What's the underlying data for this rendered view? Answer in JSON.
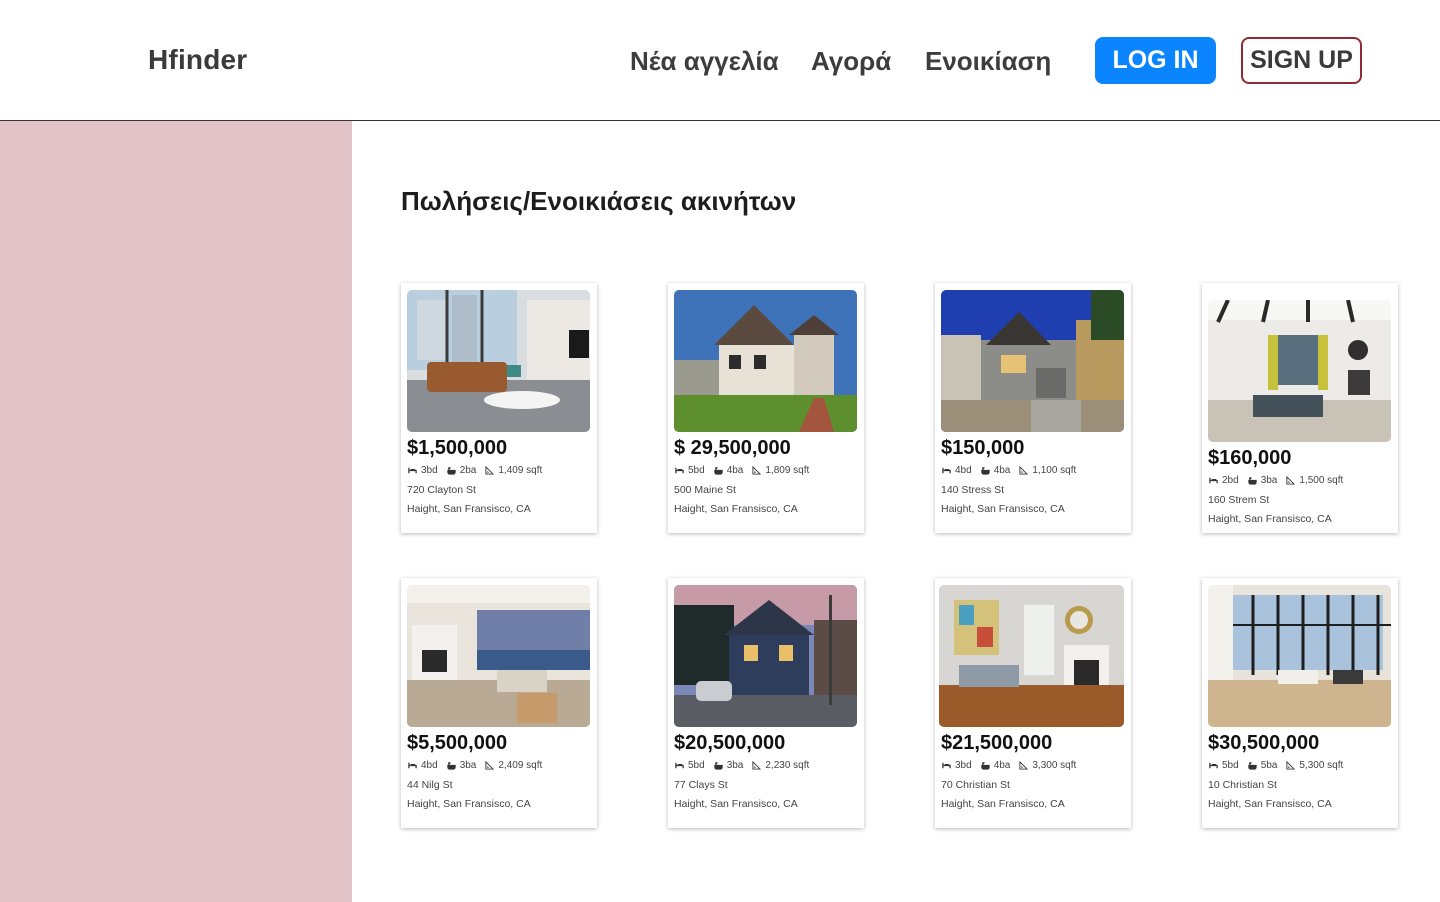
{
  "header": {
    "brand": "Hfinder",
    "nav": {
      "new_listing": "Νέα αγγελία",
      "buy": "Αγορά",
      "rent": "Ενοικίαση"
    },
    "login_label": "LOG IN",
    "signup_label": "SIGN UP"
  },
  "colors": {
    "login_bg": "#0a84ff",
    "signup_border": "#8f2a36",
    "sidebar_bg": "#e2c3c8"
  },
  "main": {
    "title": "Πωλήσεις/Ενοικιάσεις ακινήτων",
    "listings": [
      {
        "price": "$1,500,000",
        "beds": "3bd",
        "baths": "2ba",
        "area": "1,409 sqft",
        "street": "720 Clayton St",
        "city": "Haight, San Fransisco, CA",
        "photo": "living-room-photo"
      },
      {
        "price": "$ 29,500,000",
        "beds": "5bd",
        "baths": "4ba",
        "area": "1,809 sqft",
        "street": "500 Maine St",
        "city": "Haight, San Fransisco, CA",
        "photo": "tudor-house-photo"
      },
      {
        "price": "$150,000",
        "beds": "4bd",
        "baths": "4ba",
        "area": "1,100 sqft",
        "street": "140 Stress St",
        "city": "Haight, San Fransisco, CA",
        "photo": "house-exterior-photo"
      },
      {
        "price": "$160,000",
        "beds": "2bd",
        "baths": "3ba",
        "area": "1,500 sqft",
        "street": "160 Strem St",
        "city": "Haight, San Fransisco, CA",
        "photo": "living-room-photo"
      },
      {
        "price": "$5,500,000",
        "beds": "4bd",
        "baths": "3ba",
        "area": "2,409 sqft",
        "street": "44 Nilg St",
        "city": "Haight, San Fransisco, CA",
        "photo": "living-room-photo"
      },
      {
        "price": "$20,500,000",
        "beds": "5bd",
        "baths": "3ba",
        "area": "2,230 sqft",
        "street": "77 Clays St",
        "city": "Haight, San Fransisco, CA",
        "photo": "house-exterior-photo"
      },
      {
        "price": "$21,500,000",
        "beds": "3bd",
        "baths": "4ba",
        "area": "3,300 sqft",
        "street": "70 Christian St",
        "city": "Haight, San Fransisco, CA",
        "photo": "living-room-photo"
      },
      {
        "price": "$30,500,000",
        "beds": "5bd",
        "baths": "5ba",
        "area": "5,300 sqft",
        "street": "10 Christian St",
        "city": "Haight, San Fransisco, CA",
        "photo": "loft-interior-photo"
      }
    ]
  }
}
